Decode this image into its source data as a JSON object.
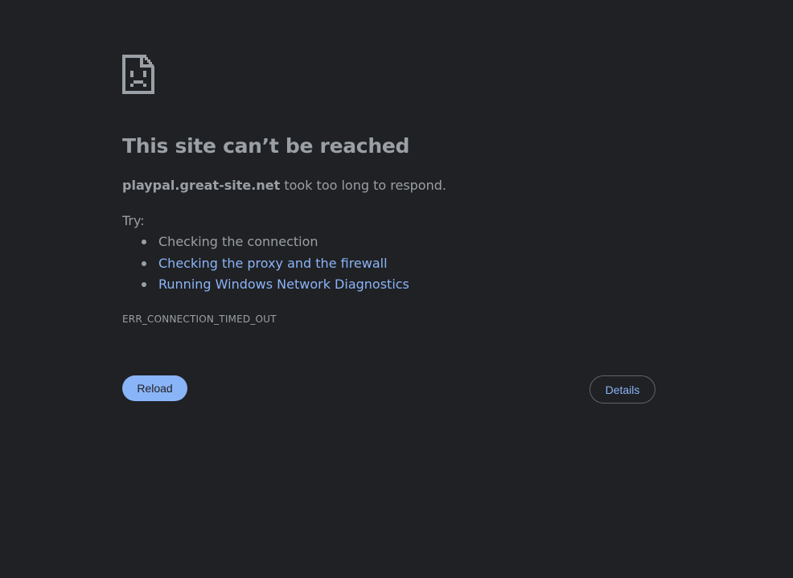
{
  "error_page": {
    "icon": "sad-document-icon",
    "title": "This site can’t be reached",
    "host": "playpal.great-site.net",
    "message_suffix": " took too long to respond.",
    "try_label": "Try:",
    "suggestions": [
      {
        "label": "Checking the connection",
        "is_link": false
      },
      {
        "label": "Checking the proxy and the firewall",
        "is_link": true
      },
      {
        "label": "Running Windows Network Diagnostics",
        "is_link": true
      }
    ],
    "error_code": "ERR_CONNECTION_TIMED_OUT",
    "reload_label": "Reload",
    "details_label": "Details"
  },
  "colors": {
    "background": "#202124",
    "text": "#9aa0a6",
    "link": "#8ab4f8",
    "reload_button": "#8ab4f8",
    "details_border": "#5f6368"
  }
}
